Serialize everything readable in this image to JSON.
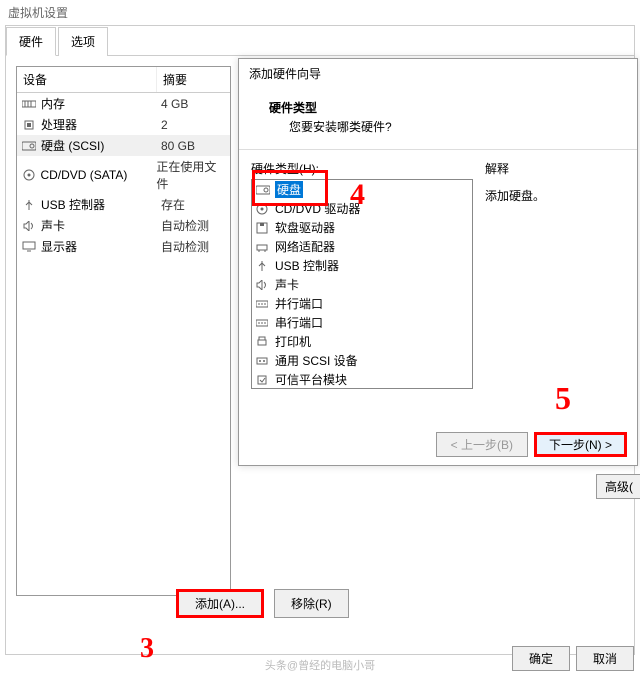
{
  "window": {
    "title": "虚拟机设置"
  },
  "tabs": {
    "hardware": "硬件",
    "options": "选项"
  },
  "devices": {
    "header_device": "设备",
    "header_summary": "摘要",
    "rows": [
      {
        "name": "内存",
        "value": "4 GB",
        "icon": "memory"
      },
      {
        "name": "处理器",
        "value": "2",
        "icon": "cpu"
      },
      {
        "name": "硬盘 (SCSI)",
        "value": "80 GB",
        "icon": "disk",
        "selected": true
      },
      {
        "name": "CD/DVD (SATA)",
        "value": "正在使用文件",
        "icon": "cd"
      },
      {
        "name": "USB 控制器",
        "value": "存在",
        "icon": "usb"
      },
      {
        "name": "声卡",
        "value": "自动检测",
        "icon": "sound"
      },
      {
        "name": "显示器",
        "value": "自动检测",
        "icon": "display"
      }
    ]
  },
  "buttons": {
    "add": "添加(A)...",
    "remove": "移除(R)",
    "ok": "确定",
    "cancel": "取消",
    "advanced": "高级("
  },
  "wizard": {
    "title": "添加硬件向导",
    "heading": "硬件类型",
    "question": "您要安装哪类硬件?",
    "list_label": "硬件类型(H):",
    "explain_label": "解释",
    "explain_text": "添加硬盘。",
    "items": [
      {
        "label": "硬盘",
        "icon": "disk",
        "selected": true
      },
      {
        "label": "CD/DVD 驱动器",
        "icon": "cd"
      },
      {
        "label": "软盘驱动器",
        "icon": "floppy"
      },
      {
        "label": "网络适配器",
        "icon": "net"
      },
      {
        "label": "USB 控制器",
        "icon": "usb"
      },
      {
        "label": "声卡",
        "icon": "sound"
      },
      {
        "label": "并行端口",
        "icon": "port"
      },
      {
        "label": "串行端口",
        "icon": "port"
      },
      {
        "label": "打印机",
        "icon": "printer"
      },
      {
        "label": "通用 SCSI 设备",
        "icon": "scsi"
      },
      {
        "label": "可信平台模块",
        "icon": "tpm"
      }
    ],
    "back": "< 上一步(B)",
    "next": "下一步(N) >"
  },
  "annotations": {
    "n3": "3",
    "n4": "4",
    "n5": "5"
  },
  "watermark": "头条@曾经的电脑小哥"
}
